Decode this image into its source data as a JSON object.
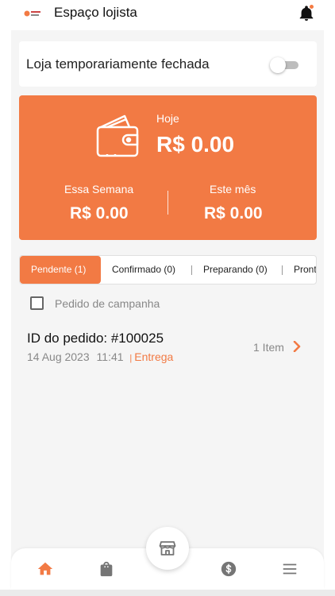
{
  "header": {
    "logo_icon": "store-logo-icon",
    "title": "Espaço lojista",
    "notification_icon": "bell-icon"
  },
  "store_status": {
    "label": "Loja temporariamente fechada",
    "toggle_on": false
  },
  "revenue": {
    "wallet_icon": "wallet-icon",
    "today_label": "Hoje",
    "today_value": "R$ 0.00",
    "week_label": "Essa Semana",
    "week_value": "R$ 0.00",
    "month_label": "Este mês",
    "month_value": "R$ 0.00"
  },
  "tabs": [
    {
      "label": "Pendente (1)",
      "active": true
    },
    {
      "label": "Confirmado (0)",
      "active": false
    },
    {
      "label": "Preparando (0)",
      "active": false
    },
    {
      "label": "Pront",
      "active": false
    }
  ],
  "campaign_filter": {
    "label": "Pedido de campanha",
    "checked": false
  },
  "orders": [
    {
      "id_text": "ID do pedido: #100025",
      "date": "14 Aug 2023",
      "time": "11:41",
      "separator": "|",
      "type": "Entrega",
      "items": "1 Item"
    }
  ],
  "bottom_nav": {
    "items": [
      "home-icon",
      "shopping-bag-icon",
      "store-icon",
      "dollar-icon",
      "menu-icon"
    ],
    "active": "home-icon"
  },
  "colors": {
    "accent": "#f27a44",
    "background": "#f5f5f5"
  }
}
